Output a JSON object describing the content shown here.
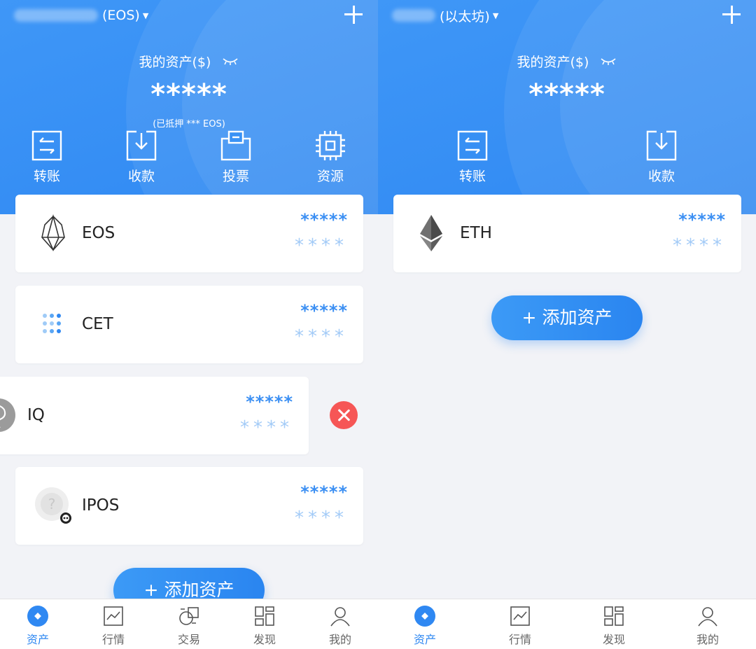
{
  "left": {
    "wallet_name": "(EOS)",
    "assets_label": "我的资产($)",
    "total_value": "*****",
    "staked_note": "(已抵押 *** EOS)",
    "actions": [
      "转账",
      "收款",
      "投票",
      "资源"
    ],
    "assets": [
      {
        "symbol": "EOS",
        "value": "*****",
        "amount": "****",
        "icon": "eos-logo-icon"
      },
      {
        "symbol": "CET",
        "value": "*****",
        "amount": "****",
        "icon": "cet-logo-icon"
      },
      {
        "symbol": "IQ",
        "value": "*****",
        "amount": "****",
        "icon": "iq-logo-icon"
      },
      {
        "symbol": "IPOS",
        "value": "*****",
        "amount": "****",
        "icon": "ipos-logo-icon"
      }
    ],
    "add_asset": "+ 添加资产",
    "tabs": [
      "资产",
      "行情",
      "交易",
      "发现",
      "我的"
    ]
  },
  "right": {
    "wallet_name": "(以太坊)",
    "assets_label": "我的资产($)",
    "total_value": "*****",
    "actions": [
      "转账",
      "收款"
    ],
    "assets": [
      {
        "symbol": "ETH",
        "value": "*****",
        "amount": "****",
        "icon": "eth-logo-icon"
      }
    ],
    "add_asset": "+ 添加资产",
    "tabs": [
      "资产",
      "行情",
      "发现",
      "我的"
    ]
  },
  "colors": {
    "primary": "#2f88f2",
    "value_blue": "#3b8ff3",
    "light_blue": "#a3cbf7",
    "danger": "#f65656",
    "background": "#f2f3f7"
  }
}
